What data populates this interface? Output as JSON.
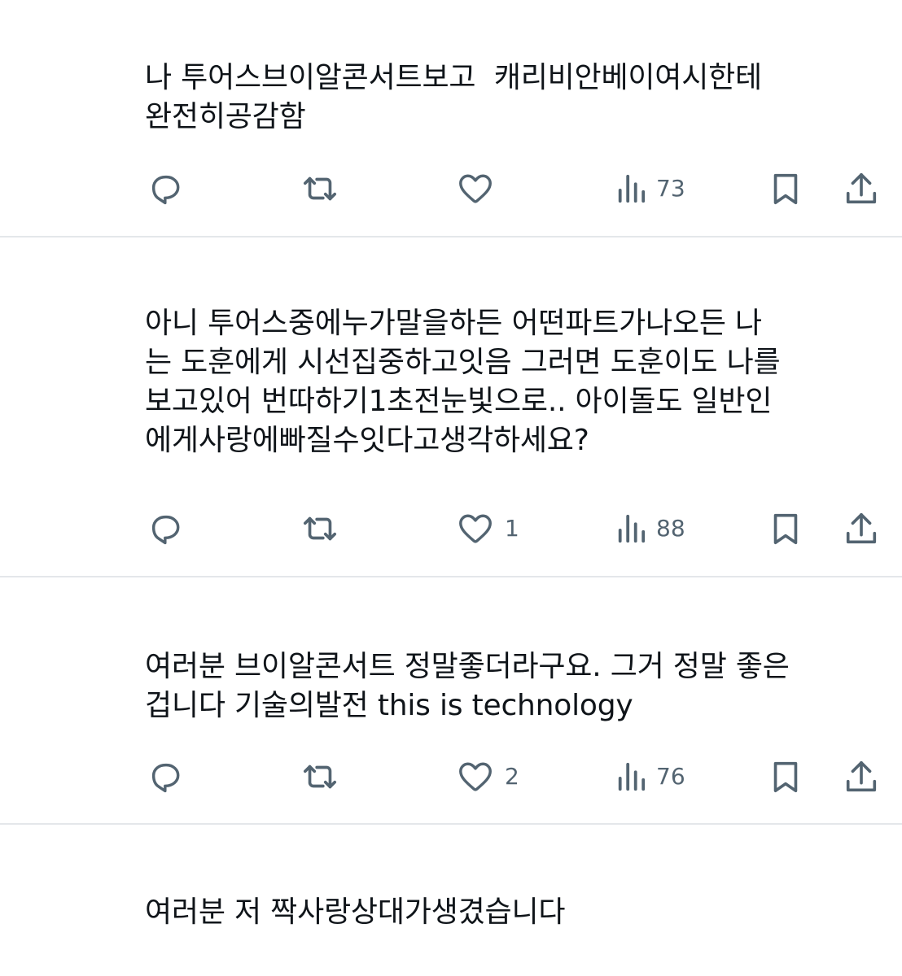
{
  "posts": [
    {
      "text": "나 투어스브이알콘서트보고  캐리비안베이여시한테\n완전히공감함",
      "reply_count": "",
      "repost_count": "",
      "like_count": "",
      "views": "73"
    },
    {
      "text": "아니 투어스중에누가말을하든 어떤파트가나오든 나\n는 도훈에게 시선집중하고잇음 그러면 도훈이도 나를\n보고있어 번따하기1초전눈빛으로.. 아이돌도 일반인\n에게사랑에빠질수잇다고생각하세요?",
      "reply_count": "",
      "repost_count": "",
      "like_count": "1",
      "views": "88"
    },
    {
      "text": "여러분 브이알콘서트 정말좋더라구요. 그거 정말 좋은\n겁니다 기술의발전 this is technology",
      "reply_count": "",
      "repost_count": "",
      "like_count": "2",
      "views": "76"
    },
    {
      "text": "여러분 저 짝사랑상대가생겼습니다"
    }
  ],
  "icons": {
    "reply": "speech-bubble-icon",
    "repost": "repost-arrows-icon",
    "like": "heart-icon",
    "views": "bar-chart-icon",
    "bookmark": "bookmark-icon",
    "share": "share-upload-icon"
  },
  "colors": {
    "icon": "#536471",
    "text": "#0f1419",
    "divider": "#e4e7ea",
    "background": "#ffffff"
  }
}
